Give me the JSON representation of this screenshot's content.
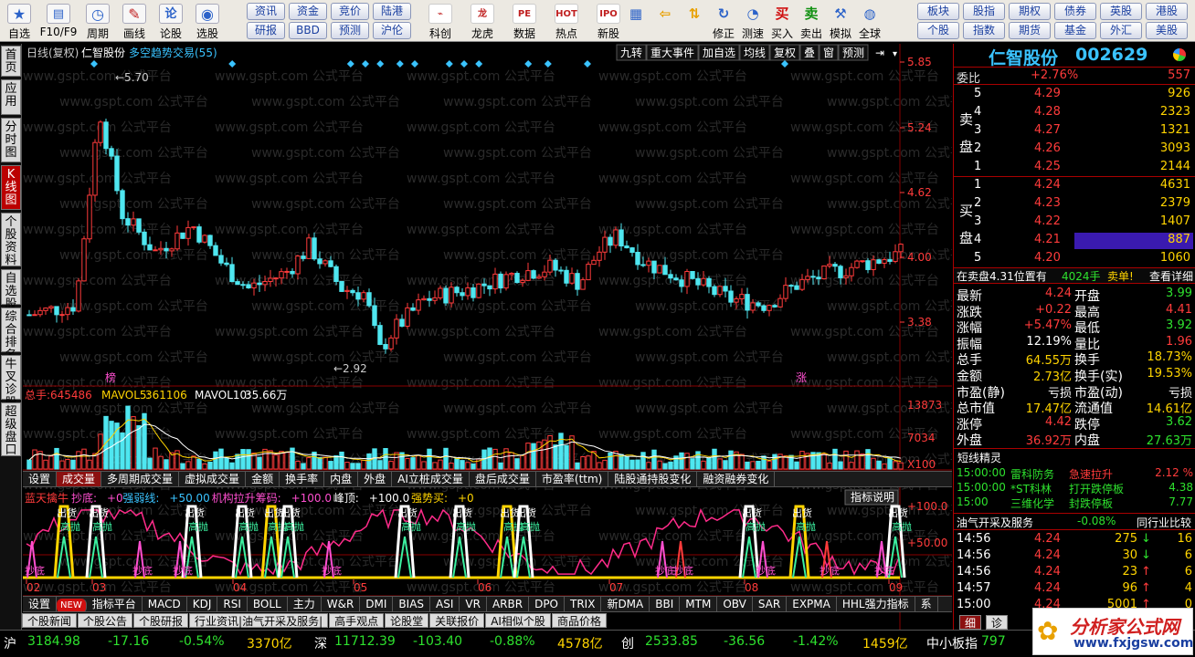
{
  "toolbar": {
    "items": [
      {
        "label": "自选",
        "icon": "star-icon",
        "color": "#2b62c9"
      },
      {
        "label": "F10/F9",
        "icon": "f10-icon",
        "color": "#2b62c9"
      },
      {
        "label": "周期",
        "icon": "clock-icon",
        "color": "#2b62c9"
      },
      {
        "label": "画线",
        "icon": "pencil-icon",
        "color": "#c02020"
      },
      {
        "label": "论股",
        "icon": "talk-icon",
        "color": "#2b62c9"
      },
      {
        "label": "选股",
        "icon": "chart-gauge-icon",
        "color": "#2b62c9"
      }
    ],
    "small_buttons": [
      "资讯",
      "资金",
      "竞价",
      "陆港",
      "研报",
      "BBD",
      "预测",
      "沪伦"
    ],
    "items2": [
      {
        "label": "科创",
        "icon": "kechuang-icon"
      },
      {
        "label": "龙虎",
        "icon": "dragon-icon"
      },
      {
        "label": "数据",
        "icon": "data-icon"
      },
      {
        "label": "热点",
        "icon": "hot-icon"
      },
      {
        "label": "新股",
        "icon": "ipo-icon"
      }
    ],
    "items3": [
      {
        "label": "",
        "icon": "windows-icon"
      },
      {
        "label": "",
        "icon": "back-arrow-icon"
      },
      {
        "label": "",
        "icon": "up-down-arrow-icon"
      },
      {
        "label": "修正",
        "icon": "fix-icon"
      },
      {
        "label": "测速",
        "icon": "speed-icon"
      },
      {
        "label": "买入",
        "icon": "buy-icon"
      },
      {
        "label": "卖出",
        "icon": "sell-icon"
      },
      {
        "label": "模拟",
        "icon": "hammer-icon"
      },
      {
        "label": "全球",
        "icon": "globe-icon"
      }
    ],
    "right_buttons": [
      "板块",
      "股指",
      "期权",
      "债券",
      "英股",
      "港股",
      "个股",
      "指数",
      "期货",
      "基金",
      "外汇",
      "美股"
    ]
  },
  "leftnav": [
    "首页",
    "应用",
    "分时图",
    "K线图",
    "个股资料",
    "自选股",
    "综合排名",
    "牛叉诊股",
    "超级盘口"
  ],
  "chart": {
    "header": {
      "period": "日线(复权)",
      "name": "仁智股份",
      "indicator": "多空趋势交易(55)"
    },
    "top_buttons": [
      "九转",
      "重大事件",
      "加自选",
      "均线",
      "复权",
      "叠",
      "窗",
      "预测"
    ],
    "price_axis": [
      "5.85",
      "5.24",
      "4.62",
      "4.00",
      "3.38"
    ],
    "high_label": "5.70",
    "low_label": "2.92",
    "marker_bang": "榜",
    "marker_zhang": "涨",
    "vol": {
      "total_label": "总手:",
      "total": "645486",
      "ma5_label": "MAVOL5:",
      "ma5": "361106",
      "ma10_label": "MAVOL10:",
      "ma10": "35.66万",
      "axis": [
        "13873",
        "7034",
        "X100"
      ]
    },
    "tabs_a": [
      "设置",
      "成交量",
      "多周期成交量",
      "虚拟成交量",
      "金额",
      "换手率",
      "内盘",
      "外盘",
      "AI立桩成交量",
      "盘后成交量",
      "市盈率(ttm)",
      "陆股通持股变化",
      "融资融券变化"
    ],
    "ind": {
      "l1": "蓝天擒牛",
      "l2": "抄底:",
      "v2": "+0",
      "l3": "强弱线:",
      "v3": "+50.00",
      "l4": "机构拉升筹码:",
      "v4": "+100.0",
      "l5": "峰顶:",
      "v5": "+100.0",
      "l6": "强势买:",
      "v6": "+0",
      "explain": "指标说明",
      "axis": [
        "+100.0",
        "+50.00"
      ],
      "word_out": "出货",
      "word_sell": "高抛",
      "word_bottom": "抄底",
      "word_suck": "低吸"
    },
    "months": [
      "02",
      "03",
      "04",
      "05",
      "06",
      "07",
      "08",
      "09"
    ],
    "tabs_b": [
      "设置",
      "NEW",
      "指标平台",
      "MACD",
      "KDJ",
      "RSI",
      "BOLL",
      "主力",
      "W&R",
      "DMI",
      "BIAS",
      "ASI",
      "VR",
      "ARBR",
      "DPO",
      "TRIX",
      "新DMA",
      "BBI",
      "MTM",
      "OBV",
      "SAR",
      "EXPMA",
      "HHL强力指标",
      "系"
    ]
  },
  "bottom_tabs": [
    "个股新闻",
    "个股公告",
    "个股研报",
    "行业资讯|油气开采及服务|",
    "高手观点",
    "论股堂",
    "关联报价",
    "AI相似个股",
    "商品价格"
  ],
  "right": {
    "title": "仁智股份",
    "code": "002629",
    "weibi_label": "委比",
    "weibi": "+2.76%",
    "weicha": "557",
    "sell_label": "卖盘",
    "buy_label": "买盘",
    "sells": [
      {
        "lv": "5",
        "p": "4.29",
        "v": "926"
      },
      {
        "lv": "4",
        "p": "4.28",
        "v": "2323"
      },
      {
        "lv": "3",
        "p": "4.27",
        "v": "1321"
      },
      {
        "lv": "2",
        "p": "4.26",
        "v": "3093"
      },
      {
        "lv": "1",
        "p": "4.25",
        "v": "2144"
      }
    ],
    "buys": [
      {
        "lv": "1",
        "p": "4.24",
        "v": "4631"
      },
      {
        "lv": "2",
        "p": "4.23",
        "v": "2379"
      },
      {
        "lv": "3",
        "p": "4.22",
        "v": "1407"
      },
      {
        "lv": "4",
        "p": "4.21",
        "v": "887"
      },
      {
        "lv": "5",
        "p": "4.20",
        "v": "1060"
      }
    ],
    "order_note": "在卖盘4.31位置有",
    "order_vol": "4024手",
    "order_act": "卖单!",
    "order_more": "查看详细",
    "quotes": [
      {
        "k1": "最新",
        "v1": "4.24",
        "c1": "red",
        "k2": "开盘",
        "v2": "3.99",
        "c2": "grn"
      },
      {
        "k1": "涨跌",
        "v1": "+0.22",
        "c1": "red",
        "k2": "最高",
        "v2": "4.41",
        "c2": "red"
      },
      {
        "k1": "涨幅",
        "v1": "+5.47%",
        "c1": "red",
        "k2": "最低",
        "v2": "3.92",
        "c2": "grn"
      },
      {
        "k1": "振幅",
        "v1": "12.19%",
        "c1": "wht",
        "k2": "量比",
        "v2": "1.96",
        "c2": "red"
      },
      {
        "k1": "总手",
        "v1": "64.55万",
        "c1": "yel",
        "k2": "换手",
        "v2": "18.73%",
        "c2": "yel"
      },
      {
        "k1": "金额",
        "v1": "2.73亿",
        "c1": "yel",
        "k2": "换手(实)",
        "v2": "19.53%",
        "c2": "yel"
      },
      {
        "k1": "市盈(静)",
        "v1": "亏损",
        "c1": "wht",
        "k2": "市盈(动)",
        "v2": "亏损",
        "c2": "wht"
      },
      {
        "k1": "总市值",
        "v1": "17.47亿",
        "c1": "yel",
        "k2": "流通值",
        "v2": "14.61亿",
        "c2": "yel"
      },
      {
        "k1": "涨停",
        "v1": "4.42",
        "c1": "red",
        "k2": "跌停",
        "v2": "3.62",
        "c2": "grn"
      },
      {
        "k1": "外盘",
        "v1": "36.92万",
        "c1": "red",
        "k2": "内盘",
        "v2": "27.63万",
        "c2": "grn"
      }
    ],
    "elves_title": "短线精灵",
    "elves": [
      {
        "t": "15:00:00",
        "n": "雷科防务",
        "e": "急速拉升",
        "v": "2.12 %"
      },
      {
        "t": "15:00:00",
        "n": "*ST科林",
        "e": "打开跌停板",
        "v": "4.38"
      },
      {
        "t": "15:00",
        "n": "三维化学",
        "e": "封跌停板",
        "v": "7.77"
      }
    ],
    "industry": "油气开采及服务",
    "industry_chg": "-0.08%",
    "compare": "同行业比较",
    "ticks": [
      {
        "t": "14:56",
        "p": "4.24",
        "v": "275",
        "d": "down",
        "n": "16"
      },
      {
        "t": "14:56",
        "p": "4.24",
        "v": "30",
        "d": "down",
        "n": "6"
      },
      {
        "t": "14:56",
        "p": "4.24",
        "v": "23",
        "d": "up",
        "n": "6"
      },
      {
        "t": "14:57",
        "p": "4.24",
        "v": "96",
        "d": "up",
        "n": "4"
      },
      {
        "t": "15:00",
        "p": "4.24",
        "v": "5001",
        "d": "up",
        "n": "0"
      }
    ],
    "detail_tab": "细",
    "diag_tab": "诊"
  },
  "status": {
    "sh": "沪",
    "sh_idx": "3184.98",
    "sh_chg": "-17.16",
    "sh_pct": "-0.54%",
    "sh_amt": "3370亿",
    "sz": "深",
    "sz_idx": "11712.39",
    "sz_chg": "-103.40",
    "sz_pct": "-0.88%",
    "sz_amt": "4578亿",
    "cy": "创",
    "cy_idx": "2533.85",
    "cy_chg": "-36.56",
    "cy_pct": "-1.42%",
    "cy_amt": "1459亿",
    "zx": "中小板指",
    "zx_idx": "797"
  },
  "watermark": {
    "brand": "分析家公式网",
    "url": "www.fxjgsw.com",
    "bg": "www.gspt.com  公式平台"
  },
  "colors": {
    "up": "#ff3b3b",
    "down": "#4fe6f0",
    "accent": "#8c1010"
  }
}
